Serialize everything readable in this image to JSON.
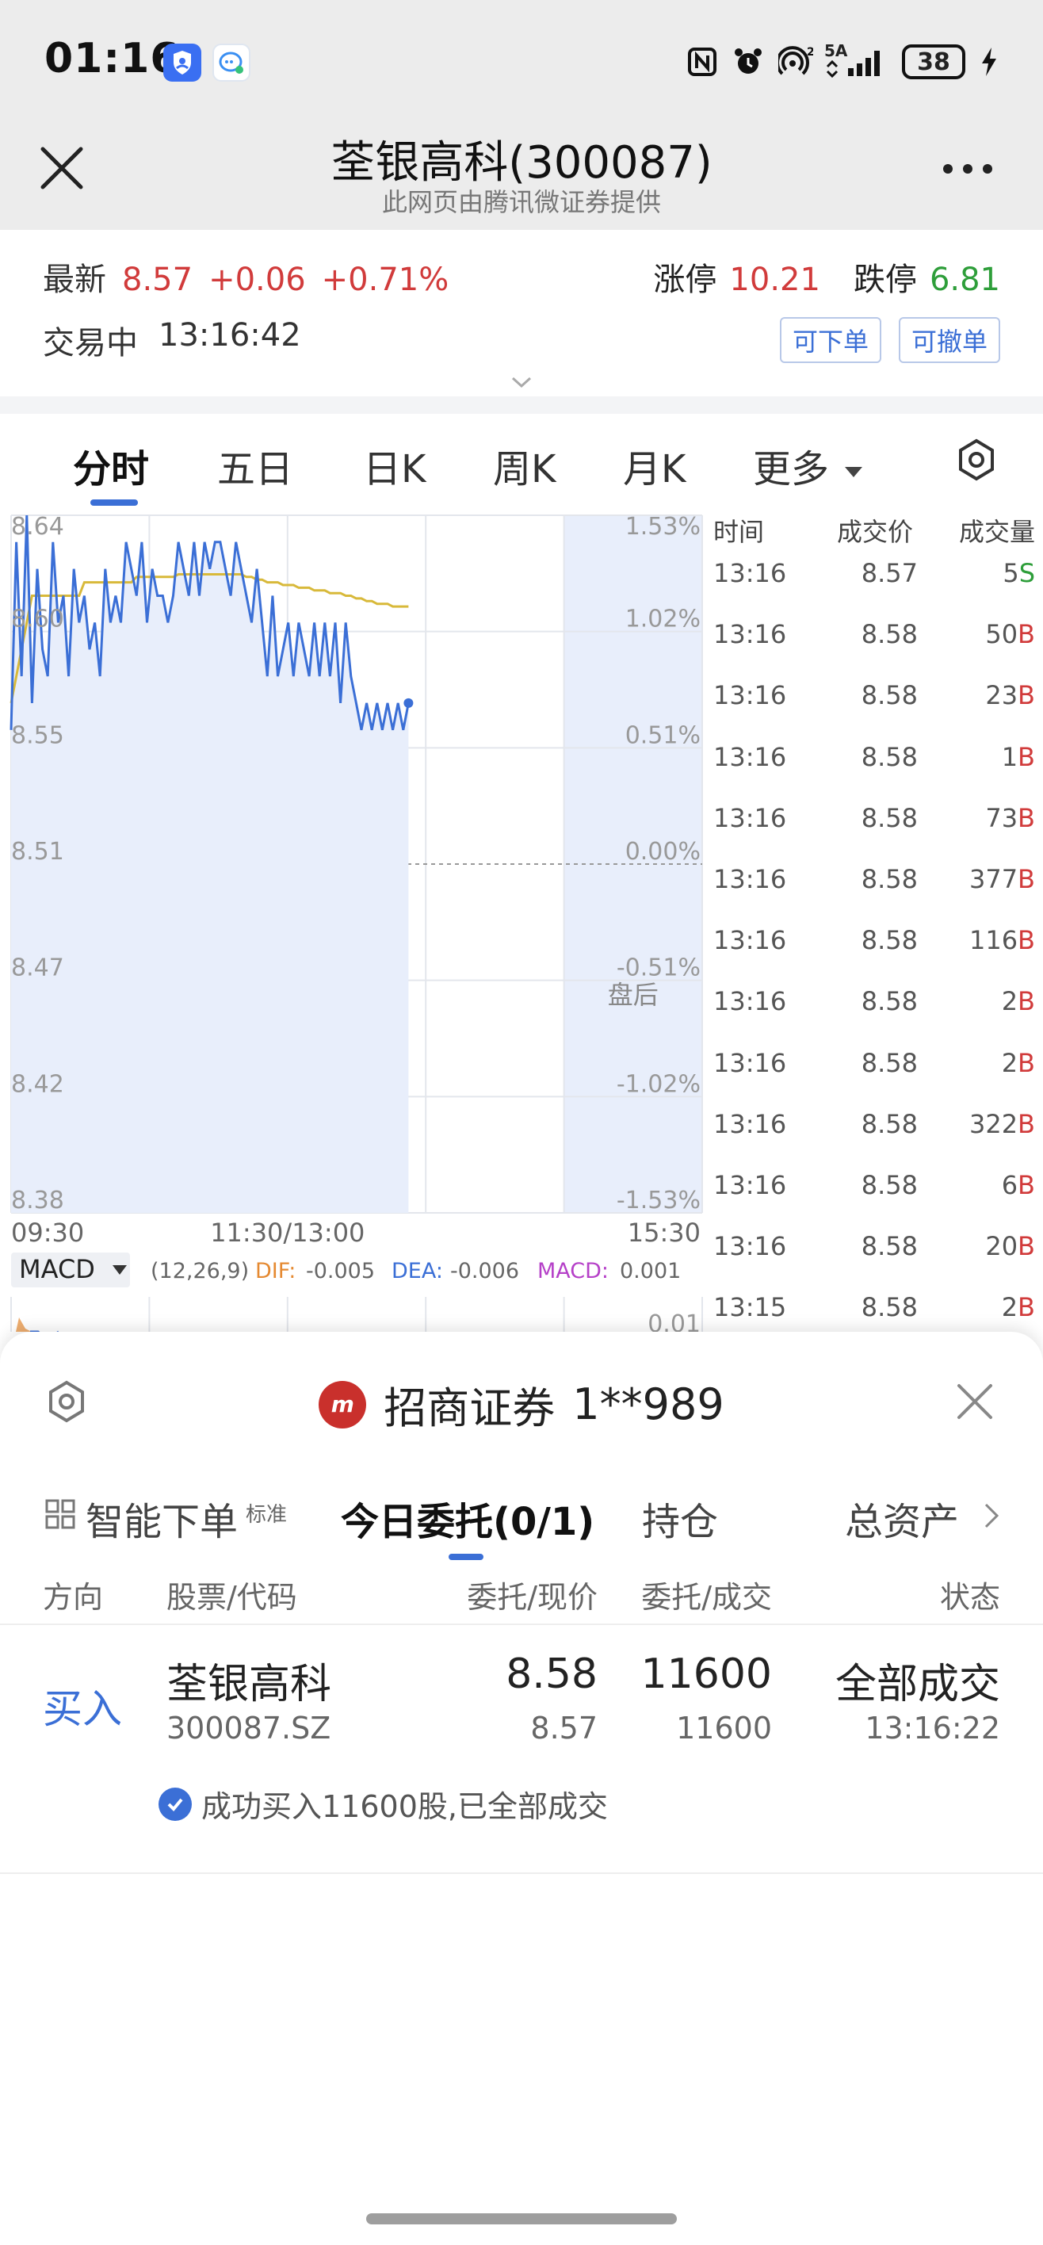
{
  "status_bar": {
    "time": "01:16",
    "network": "5A",
    "signal_sub": "2",
    "battery": "38"
  },
  "title_bar": {
    "title": "荃银高科(300087)",
    "subtitle": "此网页由腾讯微证券提供"
  },
  "quote": {
    "latest_label": "最新",
    "latest_price": "8.57",
    "change": "+0.06",
    "change_pct": "+0.71%",
    "limit_up_label": "涨停",
    "limit_up": "10.21",
    "limit_down_label": "跌停",
    "limit_down": "6.81",
    "state": "交易中",
    "time": "13:16:42",
    "btn_order": "可下单",
    "btn_cancel": "可撤单"
  },
  "chart_tabs": [
    {
      "label": "分时"
    },
    {
      "label": "五日"
    },
    {
      "label": "日K"
    },
    {
      "label": "周K"
    },
    {
      "label": "月K"
    },
    {
      "label": "更多"
    }
  ],
  "chart_data": {
    "type": "line",
    "y_price_ticks": [
      "8.64",
      "8.60",
      "8.55",
      "8.51",
      "8.47",
      "8.42",
      "8.38"
    ],
    "y_pct_ticks": [
      "1.53%",
      "1.02%",
      "0.51%",
      "0.00%",
      "-0.51%",
      "-1.02%",
      "-1.53%"
    ],
    "x_ticks": [
      "09:30",
      "11:30/13:00",
      "15:30"
    ],
    "after_hours_label": "盘后",
    "ylim": [
      8.38,
      8.64
    ],
    "prev_close": 8.51,
    "series": [
      {
        "values": [
          8.56,
          8.63,
          8.58,
          8.64,
          8.57,
          8.62,
          8.59,
          8.58,
          8.63,
          8.6,
          8.61,
          8.58,
          8.62,
          8.6,
          8.61,
          8.59,
          8.6,
          8.58,
          8.62,
          8.6,
          8.61,
          8.6,
          8.63,
          8.62,
          8.61,
          8.63,
          8.6,
          8.62,
          8.61,
          8.61,
          8.6,
          8.61,
          8.63,
          8.62,
          8.61,
          8.63,
          8.61,
          8.63,
          8.62,
          8.63,
          8.63,
          8.62,
          8.61,
          8.63,
          8.62,
          8.61,
          8.6,
          8.62,
          8.6,
          8.58,
          8.61,
          8.58,
          8.59,
          8.6,
          8.58,
          8.6,
          8.59,
          8.58,
          8.6,
          8.58,
          8.6,
          8.58,
          8.6,
          8.57,
          8.6,
          8.58,
          8.57,
          8.56,
          8.57,
          8.56,
          8.57,
          8.56,
          8.57,
          8.56,
          8.57,
          8.56,
          8.57
        ]
      },
      {
        "values": [
          8.57,
          8.58,
          8.59,
          8.6,
          8.61,
          8.61,
          8.61,
          8.61,
          8.61,
          8.61,
          8.61,
          8.61,
          8.61,
          8.61,
          8.615,
          8.615,
          8.615,
          8.615,
          8.615,
          8.615,
          8.615,
          8.615,
          8.615,
          8.615,
          8.617,
          8.617,
          8.617,
          8.617,
          8.617,
          8.617,
          8.617,
          8.617,
          8.618,
          8.618,
          8.618,
          8.618,
          8.618,
          8.618,
          8.618,
          8.618,
          8.618,
          8.618,
          8.618,
          8.618,
          8.618,
          8.617,
          8.617,
          8.616,
          8.616,
          8.615,
          8.615,
          8.615,
          8.614,
          8.614,
          8.614,
          8.613,
          8.613,
          8.613,
          8.612,
          8.612,
          8.612,
          8.611,
          8.611,
          8.611,
          8.61,
          8.61,
          8.609,
          8.609,
          8.608,
          8.608,
          8.607,
          8.607,
          8.607,
          8.606,
          8.606,
          8.606,
          8.606
        ]
      }
    ],
    "macd": {
      "label": "MACD",
      "params": "(12,26,9)",
      "dif_label": "DIF:",
      "dif": "-0.005",
      "dea_label": "DEA:",
      "dea": "-0.006",
      "macd_label": "MACD:",
      "macd": "0.001",
      "right_tick": "0.01"
    },
    "colors": {
      "price_line": "#3b6fd6",
      "avg_line": "#d8b93a",
      "fill": "#e8eefb"
    }
  },
  "trades": {
    "headers": {
      "time": "时间",
      "price": "成交价",
      "volume": "成交量"
    },
    "rows": [
      {
        "time": "13:16",
        "price": "8.57",
        "volume": "5",
        "side": "S"
      },
      {
        "time": "13:16",
        "price": "8.58",
        "volume": "50",
        "side": "B"
      },
      {
        "time": "13:16",
        "price": "8.58",
        "volume": "23",
        "side": "B"
      },
      {
        "time": "13:16",
        "price": "8.58",
        "volume": "1",
        "side": "B"
      },
      {
        "time": "13:16",
        "price": "8.58",
        "volume": "73",
        "side": "B"
      },
      {
        "time": "13:16",
        "price": "8.58",
        "volume": "377",
        "side": "B"
      },
      {
        "time": "13:16",
        "price": "8.58",
        "volume": "116",
        "side": "B"
      },
      {
        "time": "13:16",
        "price": "8.58",
        "volume": "2",
        "side": "B"
      },
      {
        "time": "13:16",
        "price": "8.58",
        "volume": "2",
        "side": "B"
      },
      {
        "time": "13:16",
        "price": "8.58",
        "volume": "322",
        "side": "B"
      },
      {
        "time": "13:16",
        "price": "8.58",
        "volume": "6",
        "side": "B"
      },
      {
        "time": "13:16",
        "price": "8.58",
        "volume": "20",
        "side": "B"
      },
      {
        "time": "13:15",
        "price": "8.58",
        "volume": "2",
        "side": "B"
      }
    ]
  },
  "panel": {
    "broker": "招商证券",
    "account": "1**989",
    "tabs": {
      "smart_order": "智能下单",
      "smart_tag": "标准",
      "today_orders": "今日委托(0/1)",
      "positions": "持仓",
      "assets": "总资产"
    },
    "order_headers": {
      "direction": "方向",
      "stock": "股票/代码",
      "price": "委托/现价",
      "qty": "委托/成交",
      "status": "状态"
    },
    "order": {
      "direction": "买入",
      "name": "荃银高科",
      "code": "300087.SZ",
      "order_price": "8.58",
      "current_price": "8.57",
      "order_qty": "11600",
      "filled_qty": "11600",
      "status": "全部成交",
      "time": "13:16:22",
      "message": "成功买入11600股,已全部成交"
    }
  }
}
